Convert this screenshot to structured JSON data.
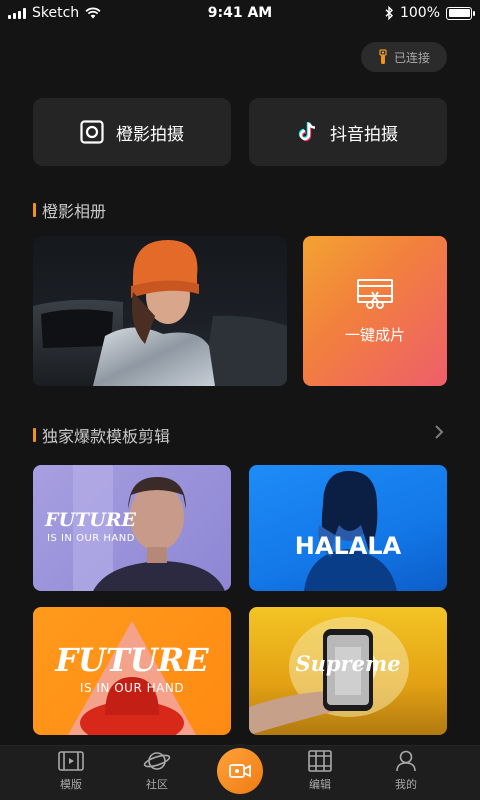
{
  "status_bar": {
    "carrier": "Sketch",
    "time": "9:41 AM",
    "battery_percent": "100%",
    "signal_icon": "signal-bars-icon",
    "wifi_icon": "wifi-icon",
    "bluetooth_icon": "bluetooth-icon",
    "battery_level": 1.0
  },
  "connection": {
    "label": "已连接",
    "icon": "gimbal-icon",
    "icon_color": "#f29516"
  },
  "capture_buttons": [
    {
      "label": "橙影拍摄",
      "icon": "instagram-icon"
    },
    {
      "label": "抖音拍摄",
      "icon": "tiktok-icon"
    }
  ],
  "album_section": {
    "title": "橙影相册",
    "one_click_label": "一键成片",
    "one_click_icon": "video-edit-icon"
  },
  "templates_section": {
    "title": "独家爆款模板剪辑",
    "more_icon": "chevron-right-icon",
    "cards": [
      {
        "title": "FUTURE",
        "subtitle": "IS IN OUR HAND"
      },
      {
        "title": "HALALA",
        "subtitle": ""
      },
      {
        "title": "FUTURE",
        "subtitle": "IS IN OUR HAND"
      },
      {
        "title": "Supreme",
        "subtitle": ""
      }
    ]
  },
  "tab_bar": {
    "tabs": [
      {
        "label": "模版",
        "icon": "template-icon"
      },
      {
        "label": "社区",
        "icon": "planet-icon"
      },
      {
        "label": "编辑",
        "icon": "film-edit-icon"
      },
      {
        "label": "我的",
        "icon": "user-icon"
      }
    ],
    "center_icon": "record-video-icon"
  },
  "colors": {
    "background": "#141414",
    "accent": "#f29516",
    "card_bg": "#252525"
  }
}
